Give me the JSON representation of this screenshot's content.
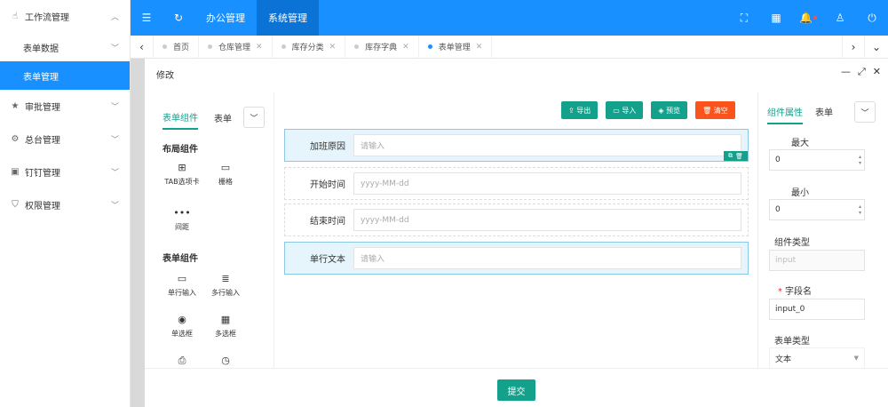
{
  "sidebar": {
    "groups": [
      {
        "label": "工作流管理",
        "icon": "hand-icon"
      },
      {
        "label": "审批管理",
        "icon": "star-icon"
      },
      {
        "label": "总台管理",
        "icon": "gear-icon"
      },
      {
        "label": "钉钉管理",
        "icon": "calendar-icon"
      },
      {
        "label": "权限管理",
        "icon": "shield-icon"
      }
    ],
    "subitems": [
      {
        "label": "表单数据"
      },
      {
        "label": "表单管理"
      }
    ]
  },
  "header": {
    "nav": [
      "办公管理",
      "系统管理"
    ],
    "active_nav": "系统管理"
  },
  "tabs": [
    {
      "label": "首页"
    },
    {
      "label": "仓库管理"
    },
    {
      "label": "库存分类"
    },
    {
      "label": "库存字典"
    },
    {
      "label": "表单管理"
    }
  ],
  "dialog": {
    "title": "修改",
    "left_tabs": [
      "表单组件",
      "表单"
    ],
    "layout_section": "布局组件",
    "layout_components": [
      "TAB选项卡",
      "栅格",
      "间距"
    ],
    "form_section": "表单组件",
    "form_components": [
      "单行输入",
      "多行输入",
      "单选框",
      "多选框"
    ],
    "toolbar": {
      "export": "导出",
      "import": "导入",
      "preview": "预览",
      "clear": "清空"
    },
    "fields": [
      {
        "label": "加班原因",
        "placeholder": "请输入"
      },
      {
        "label": "开始时间",
        "placeholder": "yyyy-MM-dd"
      },
      {
        "label": "结束时间",
        "placeholder": "yyyy-MM-dd"
      },
      {
        "label": "单行文本",
        "placeholder": "请输入"
      }
    ],
    "right_tabs": [
      "组件属性",
      "表单"
    ],
    "props": {
      "max_label": "最大",
      "max_value": "0",
      "min_label": "最小",
      "min_value": "0",
      "type_label": "组件类型",
      "type_value": "input",
      "field_label": "字段名",
      "field_value": "input_0",
      "form_type_label": "表单类型",
      "form_type_value": "文本"
    },
    "submit": "提交"
  },
  "colors": {
    "primary": "#1890ff",
    "accent": "#13a18c",
    "danger": "#fa541c"
  }
}
